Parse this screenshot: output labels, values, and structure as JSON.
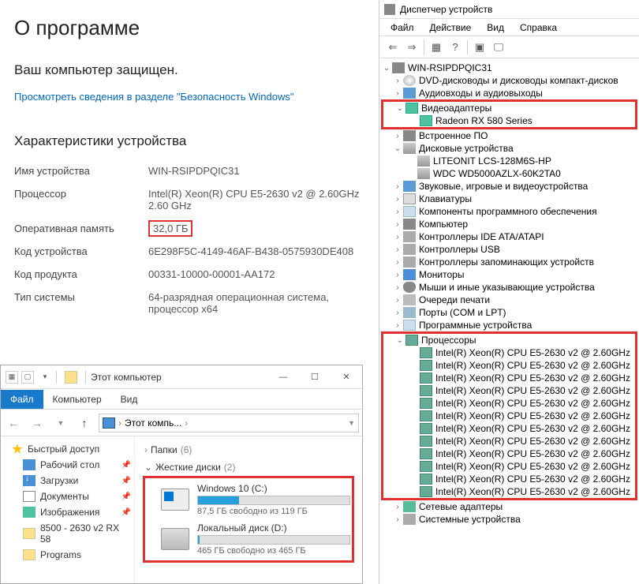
{
  "about": {
    "title": "О программе",
    "secure": "Ваш компьютер защищен.",
    "link": "Просмотреть сведения в разделе \"Безопасность Windows\"",
    "specs_title": "Характеристики устройства",
    "rows": {
      "device_name": {
        "label": "Имя устройства",
        "value": "WIN-RSIPDPQIC31"
      },
      "processor": {
        "label": "Процессор",
        "value": "Intel(R) Xeon(R) CPU E5-2630 v2 @ 2.60GHz   2.60 GHz"
      },
      "ram": {
        "label": "Оперативная память",
        "value": "32,0 ГБ"
      },
      "device_id": {
        "label": "Код устройства",
        "value": "6E298F5C-4149-46AF-B438-0575930DE408"
      },
      "product_id": {
        "label": "Код продукта",
        "value": "00331-10000-00001-AA172"
      },
      "system_type": {
        "label": "Тип системы",
        "value": "64-разрядная операционная система, процессор x64"
      }
    }
  },
  "explorer": {
    "title": "Этот компьютер",
    "tabs": {
      "file": "Файл",
      "computer": "Компьютер",
      "view": "Вид"
    },
    "breadcrumb": "Этот компь...",
    "sidebar": {
      "quick": "Быстрый доступ",
      "desktop": "Рабочий стол",
      "downloads": "Загрузки",
      "documents": "Документы",
      "pictures": "Изображения",
      "folder1": "8500 - 2630 v2 RX 58",
      "folder2": "Programs"
    },
    "sections": {
      "folders": {
        "name": "Папки",
        "count": "(6)"
      },
      "disks": {
        "name": "Жесткие диски",
        "count": "(2)"
      }
    },
    "disks": {
      "c": {
        "name": "Windows 10 (C:)",
        "free": "87,5 ГБ свободно из 119 ГБ",
        "fill_pct": 27
      },
      "d": {
        "name": "Локальный диск (D:)",
        "free": "465 ГБ свободно из 465 ГБ",
        "fill_pct": 1
      }
    }
  },
  "devmgr": {
    "title": "Диспетчер устройств",
    "menu": {
      "file": "Файл",
      "action": "Действие",
      "view": "Вид",
      "help": "Справка"
    },
    "root": "WIN-RSIPDPQIC31",
    "categories": {
      "dvd": "DVD-дисководы и дисководы компакт-дисков",
      "audio": "Аудиовходы и аудиовыходы",
      "video": "Видеоадаптеры",
      "gpu": "Radeon RX 580 Series",
      "firmware": "Встроенное ПО",
      "disk": "Дисковые устройства",
      "disk1": "LITEONIT LCS-128M6S-HP",
      "disk2": "WDC WD5000AZLX-60K2TA0",
      "sound": "Звуковые, игровые и видеоустройства",
      "keyboard": "Клавиатуры",
      "software": "Компоненты программного обеспечения",
      "computer": "Компьютер",
      "ide": "Контроллеры IDE ATA/ATAPI",
      "usb": "Контроллеры USB",
      "storage": "Контроллеры запоминающих устройств",
      "monitors": "Мониторы",
      "mouse": "Мыши и иные указывающие устройства",
      "print": "Очереди печати",
      "ports": "Порты (COM и LPT)",
      "progdev": "Программные устройства",
      "cpu": "Процессоры",
      "cpu_item": "Intel(R) Xeon(R) CPU E5-2630 v2 @ 2.60GHz",
      "network": "Сетевые адаптеры",
      "system": "Системные устройства"
    },
    "cpu_count": 12
  }
}
